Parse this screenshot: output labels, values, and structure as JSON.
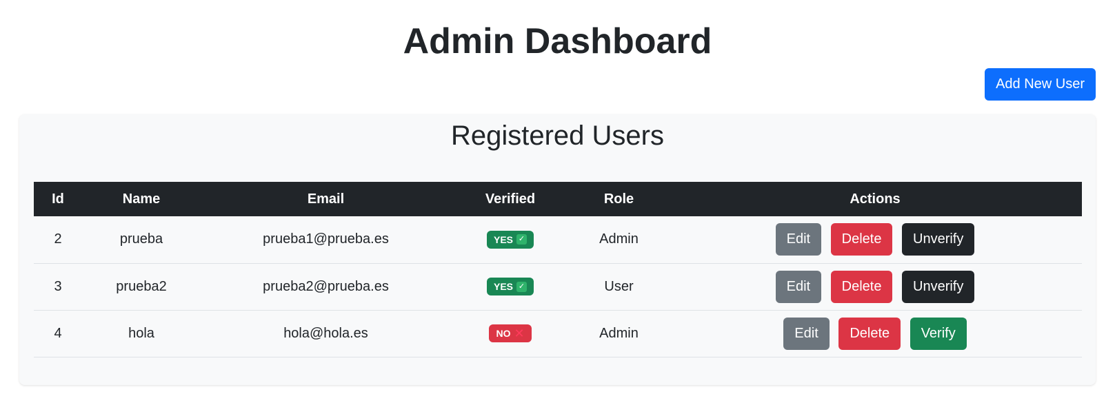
{
  "header": {
    "title": "Admin Dashboard",
    "add_user_label": "Add New User"
  },
  "users_panel": {
    "title": "Registered Users",
    "columns": [
      "Id",
      "Name",
      "Email",
      "Verified",
      "Role",
      "Actions"
    ],
    "rows": [
      {
        "id": "2",
        "name": "prueba",
        "email": "prueba1@prueba.es",
        "verified": "YES",
        "role": "Admin",
        "actions": [
          "Edit",
          "Delete",
          "Unverify"
        ]
      },
      {
        "id": "3",
        "name": "prueba2",
        "email": "prueba2@prueba.es",
        "verified": "YES",
        "role": "User",
        "actions": [
          "Edit",
          "Delete",
          "Unverify"
        ]
      },
      {
        "id": "4",
        "name": "hola",
        "email": "hola@hola.es",
        "verified": "NO",
        "role": "Admin",
        "actions": [
          "Edit",
          "Delete",
          "Verify"
        ]
      }
    ]
  },
  "colors": {
    "primary": "#0d6efd",
    "danger": "#dc3545",
    "secondary": "#6c757d",
    "dark": "#212529",
    "success": "#198754"
  },
  "icons": {
    "verified_yes": "check-icon",
    "verified_no": "cross-icon"
  }
}
